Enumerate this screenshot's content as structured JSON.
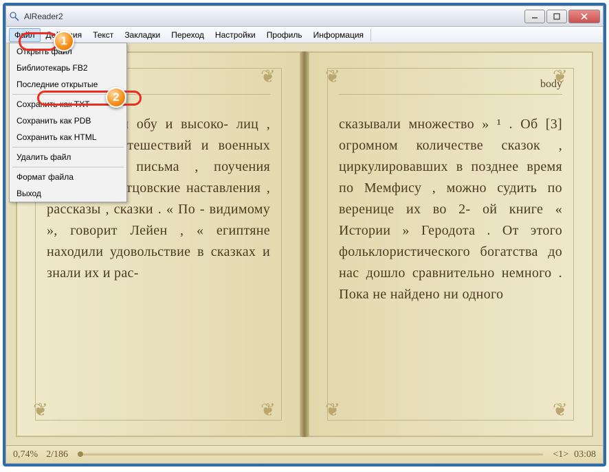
{
  "window": {
    "title": "AlReader2"
  },
  "menu": {
    "items": [
      "Файл",
      "Действия",
      "Текст",
      "Закладки",
      "Переход",
      "Настройки",
      "Профиль",
      "Информация"
    ],
    "active_index": 0
  },
  "dropdown": {
    "groups": [
      [
        "Открыть файл",
        "Библиотекарь FB2",
        "Последние открытые"
      ],
      [
        "Сохранить как TXT",
        "Сохранить как PDB",
        "Сохранить как HTML"
      ],
      [
        "Удалить файл"
      ],
      [
        "Формат файла",
        "Выход"
      ]
    ]
  },
  "badges": {
    "b1": "1",
    "b2": "2"
  },
  "pages": {
    "left": {
      "header": "",
      "text": "ати , сатиры обу и высоко- лиц , описание путешествий и военных подвигов , письма , поучения мудрецов , отцовские наставления , рассказы , сказки . « По - видимому », говорит Лейен , « египтяне находили удовольствие в сказках и знали их и рас-"
    },
    "right": {
      "header": "body",
      "text": "сказывали множество » ¹ . Об [3] огромном количестве сказок , циркулировавших в позднее время по Мемфису , можно судить по веренице их во 2- ой книге « Истории » Геродота . От этого фольклористического богатства до нас дошло сравнительно немного . Пока не найдено ни одного"
    }
  },
  "status": {
    "percent": "0,74%",
    "pages": "2/186",
    "chapter": "<1>",
    "time": "03:08"
  }
}
